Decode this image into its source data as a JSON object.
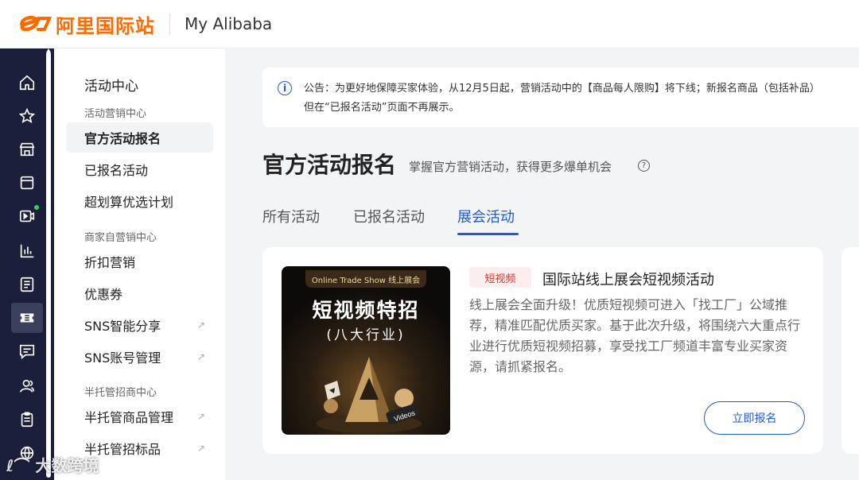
{
  "header": {
    "logo_text": "阿里国际站",
    "title": "My Alibaba",
    "brand_color": "#ff6a00"
  },
  "rail": {
    "icons": [
      "home-icon",
      "star-icon",
      "store-icon",
      "product-box-icon",
      "video-icon",
      "chart-icon",
      "ad-icon",
      "ticket-icon",
      "message-icon",
      "customers-icon",
      "clipboard-icon",
      "globe-icon"
    ],
    "active": "ticket-icon"
  },
  "subnav": {
    "title": "活动中心",
    "groups": [
      {
        "label": "活动营销中心",
        "items": [
          "官方活动报名",
          "已报名活动",
          "超划算优选计划"
        ]
      },
      {
        "label": "商家自营销中心",
        "items": [
          "折扣营销",
          "优惠券",
          "SNS智能分享",
          "SNS账号管理"
        ]
      },
      {
        "label": "半托管招商中心",
        "items": [
          "半托管商品管理",
          "半托管招标品"
        ]
      }
    ],
    "active_item": "官方活动报名",
    "external_mark": "↗"
  },
  "notice": {
    "line1": "公告：为更好地保障买家体验，从12月5日起，营销活动中的【商品每人限购】将下线；新报名商品（包括补品）",
    "line2": "但在“已报名活动”页面不再展示。"
  },
  "page": {
    "title": "官方活动报名",
    "subtitle": "掌握官方营销活动，获得更多爆单机会",
    "help_icon": "?"
  },
  "tabs": [
    {
      "label": "所有活动"
    },
    {
      "label": "已报名活动"
    },
    {
      "label": "展会活动"
    }
  ],
  "active_tab": "展会活动",
  "card": {
    "thumbnail": {
      "banner": "Online Trade Show 线上展会",
      "heading": "短视频特招",
      "subheading": "(八大行业)",
      "badge": "Videos"
    },
    "tag": "短视频",
    "title": "国际站线上展会短视频活动",
    "description": "线上展会全面升级！优质短视频可进入「找工厂」公域推荐，精准匹配优质买家。基于此次升级，将围绕六大重点行业进行优质短视频招募，享受找工厂频道丰富专业买家资源，请抓紧报名。",
    "button": "立即报名"
  },
  "watermark": "大数跨境",
  "accent_color": "#1f5bd6"
}
